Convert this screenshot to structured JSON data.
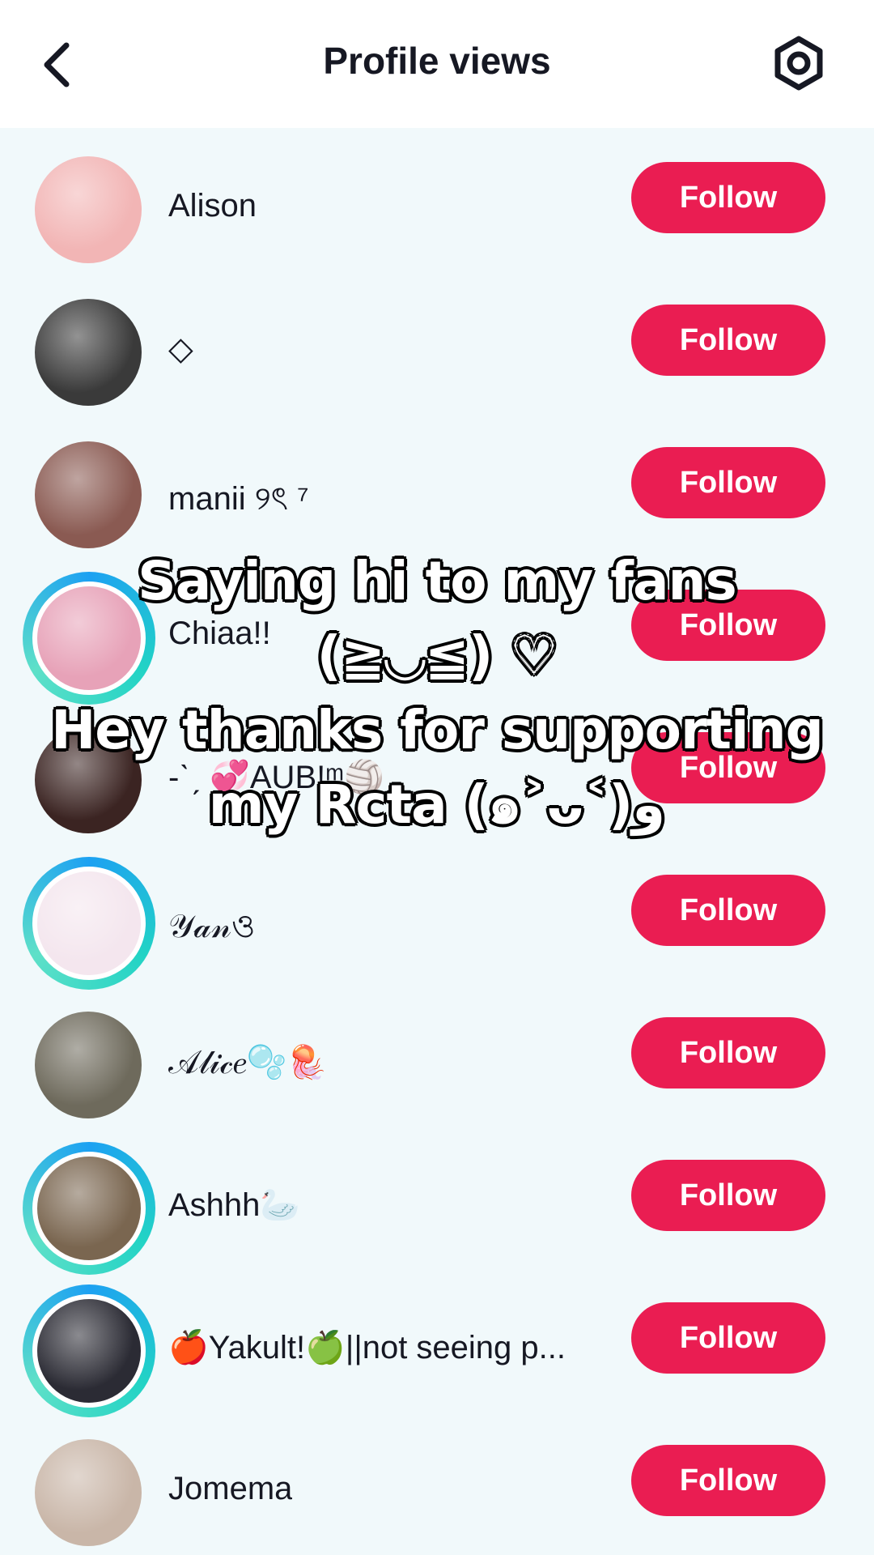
{
  "header": {
    "title": "Profile views",
    "back_icon": "chevron-left-icon",
    "settings_icon": "gear-icon"
  },
  "colors": {
    "follow_button": "#ea1d52",
    "list_background": "#f1f9fb",
    "story_ring": "#22d3c5"
  },
  "viewers": [
    {
      "name": "Alison",
      "button": "Follow",
      "story_ring": false,
      "avatar_color": "#f2b5b5"
    },
    {
      "name": "◇",
      "button": "Follow",
      "story_ring": false,
      "avatar_color": "#3a3a3a"
    },
    {
      "name": "manii ୨ৎ ⁷",
      "button": "Follow",
      "story_ring": false,
      "avatar_color": "#8a5a52"
    },
    {
      "name": "Chiaa!!",
      "button": "Follow",
      "story_ring": true,
      "avatar_color": "#e7a2b8"
    },
    {
      "name": "-ˋˏ 💞AUB!ᵐ🏐",
      "button": "Follow",
      "story_ring": false,
      "avatar_color": "#3b2422"
    },
    {
      "name": "𝒴𝒶𝓃ও",
      "button": "Follow",
      "story_ring": true,
      "avatar_color": "#f4e6ee"
    },
    {
      "name": "𝒜𝓁𝒾𝒸𝑒🫧🪼",
      "button": "Follow",
      "story_ring": false,
      "avatar_color": "#6e6a5c"
    },
    {
      "name": "Ashhh🦢",
      "button": "Follow",
      "story_ring": true,
      "avatar_color": "#7a6650"
    },
    {
      "name": "🍎Yakult!🍏||not seeing p...",
      "button": "Follow",
      "story_ring": true,
      "avatar_color": "#2b2b34"
    },
    {
      "name": "Jomema",
      "button": "Follow",
      "story_ring": false,
      "avatar_color": "#c9b6a8"
    }
  ],
  "overlay_caption": [
    "Saying hi to my fans",
    "(≧◡≦) ♡",
    "Hey thanks for supporting",
    "my Rcta    (๑˃ᴗ˂)ﻭ"
  ]
}
